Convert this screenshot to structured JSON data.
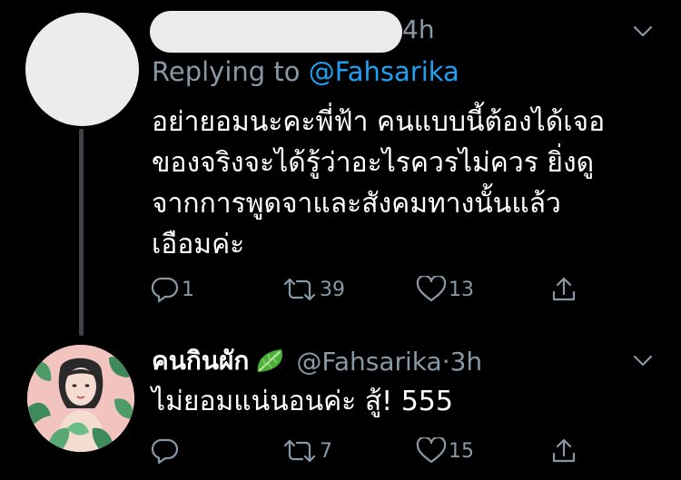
{
  "tweet1": {
    "time": "4h",
    "replying_prefix": "Replying to ",
    "replying_mention": "@Fahsarika",
    "body_lines": [
      "อย่ายอมนะคะพี่ฟ้า คนแบบนี้ต้องได้เจอ",
      "ของจริงจะได้รู้ว่าอะไรควรไม่ควร ยิ่งดู",
      "จากการพูดจาและสังคมทางนั้นแล้ว",
      "เอือมค่ะ"
    ],
    "reply_count": "1",
    "retweet_count": "39",
    "like_count": "13",
    "icons": {
      "reply": "reply-icon",
      "retweet": "retweet-icon",
      "like": "heart-icon",
      "share": "share-icon",
      "more": "chevron-down-icon"
    }
  },
  "tweet2": {
    "name": "คนกินผัก",
    "handle": "@Fahsarika",
    "separator": " · ",
    "time": "3h",
    "body": "ไม่ยอมแน่นอนค่ะ สู้! 555",
    "reply_count": "",
    "retweet_count": "7",
    "like_count": "15",
    "badge_icon": "lettuce-leaf-icon",
    "avatar": "illustrated-portrait-avatar"
  },
  "colors": {
    "background": "#000000",
    "text": "#ffffff",
    "secondary_text": "#8899a6",
    "mention": "#1da1f2",
    "thread_line": "#3d4348"
  }
}
